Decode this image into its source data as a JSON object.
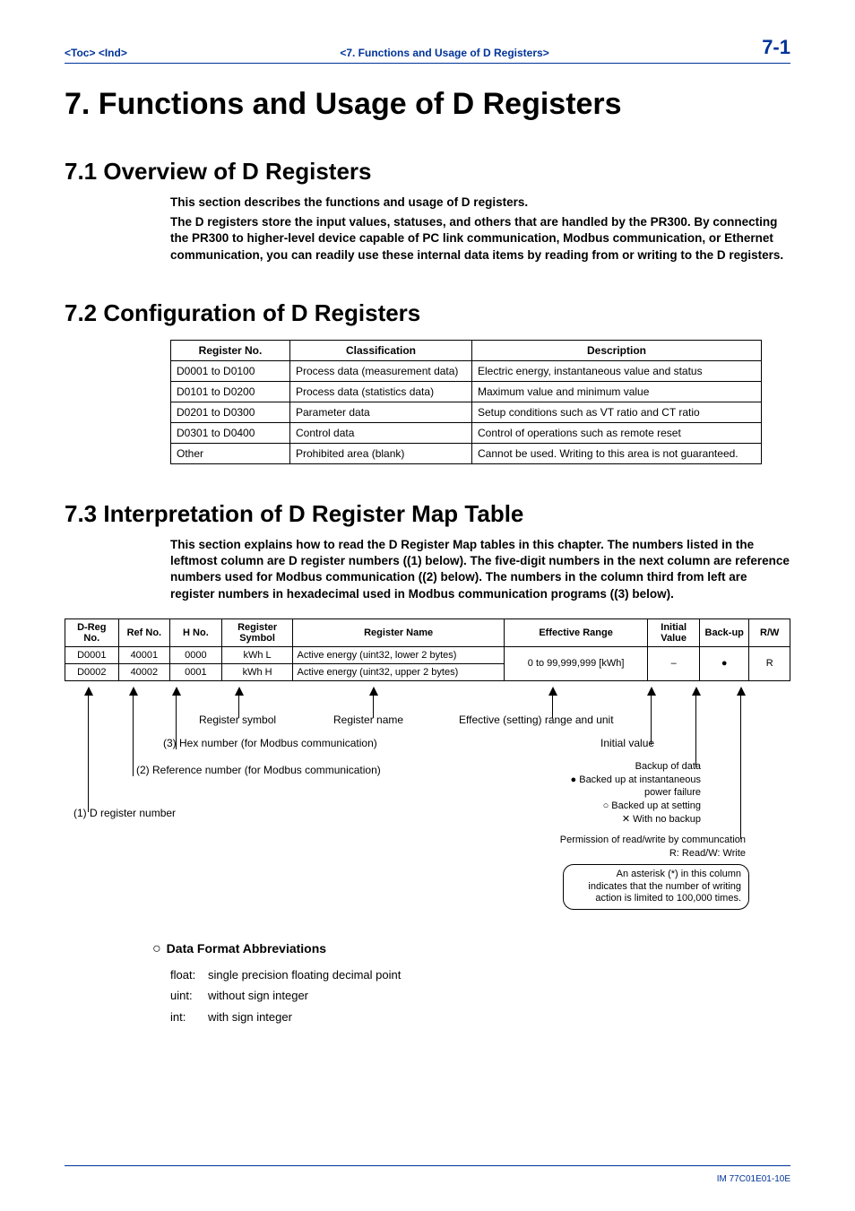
{
  "header": {
    "toc": "<Toc>",
    "ind": "<Ind>",
    "center": "<7.  Functions and Usage of D Registers>",
    "page_no": "7-1"
  },
  "chapter": {
    "title": "7.    Functions and Usage of D Registers"
  },
  "section71": {
    "title": "7.1    Overview of D Registers",
    "p1": "This section describes the functions and usage of D registers.",
    "p2": "The D registers store the input values, statuses, and others that are handled by the PR300.  By connecting the PR300 to higher-level device capable of PC link communication, Modbus communication, or Ethernet communication, you can readily use these internal data items by reading from or writing to the D registers."
  },
  "section72": {
    "title": "7.2    Configuration of D Registers",
    "table": {
      "headers": [
        "Register No.",
        "Classification",
        "Description"
      ],
      "rows": [
        [
          "D0001 to D0100",
          "Process data (measurement data)",
          "Electric energy, instantaneous value and status"
        ],
        [
          "D0101 to D0200",
          "Process data (statistics data)",
          "Maximum value and minimum value"
        ],
        [
          "D0201 to D0300",
          "Parameter data",
          "Setup conditions such as VT ratio and CT ratio"
        ],
        [
          "D0301 to D0400",
          "Control data",
          "Control of operations such as remote reset"
        ],
        [
          "Other",
          "Prohibited area (blank)",
          "Cannot be used. Writing to this area is not guaranteed."
        ]
      ]
    }
  },
  "section73": {
    "title": "7.3    Interpretation of D Register Map Table",
    "p1": "This section explains how to read the  D Register Map tables in this chapter.  The numbers listed in the leftmost column are D register numbers ((1) below).  The five-digit numbers in the next column are reference numbers used for Modbus communication ((2) below).  The numbers in the column third from left are register numbers in hexadecimal used in Modbus communication programs ((3) below).",
    "map_table": {
      "headers": [
        "D-Reg No.",
        "Ref No.",
        "H No.",
        "Register Symbol",
        "Register Name",
        "Effective Range",
        "Initial Value",
        "Back-up",
        "R/W"
      ],
      "rows": [
        {
          "dreg": "D0001",
          "ref": "40001",
          "hno": "0000",
          "sym": "kWh L",
          "name": "Active energy (uint32, lower 2 bytes)",
          "range": "0  to 99,999,999 [kWh]",
          "init": "–",
          "backup": "●",
          "rw": "R"
        },
        {
          "dreg": "D0002",
          "ref": "40002",
          "hno": "0001",
          "sym": "kWh H",
          "name": "Active energy (uint32, upper 2 bytes)",
          "range": "",
          "init": "",
          "backup": "",
          "rw": ""
        }
      ]
    },
    "annotations": {
      "a1": "(1) D register number",
      "a2": "(2) Reference number (for Modbus communication)",
      "a3": "(3) Hex number (for Modbus communication)",
      "a4": "Register symbol",
      "a5": "Register name",
      "a6": "Effective (setting) range and unit",
      "a7": "Initial value",
      "a8_title": "Backup of data",
      "a8_1": "● Backed up at instantaneous",
      "a8_2": "power failure",
      "a8_3": "○ Backed up at setting",
      "a8_4": "✕ With no backup",
      "a9_1": "Permission of read/write by communcation",
      "a9_2": "R: Read/W: Write",
      "note1": "An asterisk (*) in this column",
      "note2": "indicates that the number of writing",
      "note3": "action is limited to 100,000 times."
    },
    "format_heading": "Data Format  Abbreviations",
    "formats": {
      "float": {
        "term": "float:",
        "desc": "single precision floating decimal point"
      },
      "uint": {
        "term": "uint:",
        "desc": "without sign integer"
      },
      "int": {
        "term": "int:",
        "desc": "with sign integer"
      }
    }
  },
  "footer": {
    "doc_id": "IM 77C01E01-10E"
  }
}
